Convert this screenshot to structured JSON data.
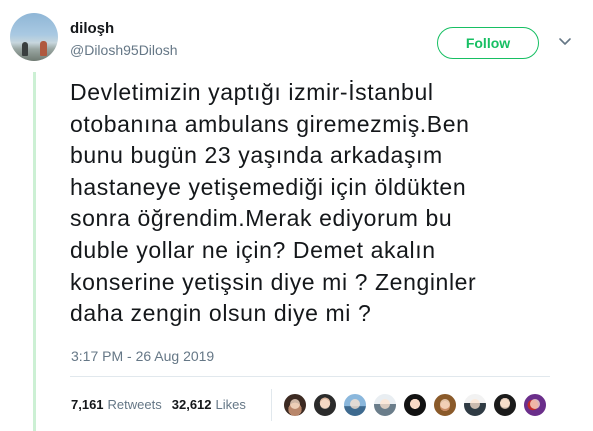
{
  "author": {
    "display_name": "diloşh",
    "handle": "@Dilosh95Dilosh"
  },
  "follow_button": {
    "label": "Follow",
    "accent_color": "#17bf63"
  },
  "menu": {
    "icon": "chevron-down-icon"
  },
  "tweet": {
    "lines": [
      "Devletimizin yaptığı izmir-İstanbul",
      "otobanına ambulans giremezmiş.Ben",
      "bunu bugün 23 yaşında arkadaşım",
      "hastaneye yetişemediği için öldükten",
      "sonra öğrendim.Merak ediyorum bu",
      "duble yollar ne için? Demet akalın",
      "konserine yetişsin diye mi ? Zenginler",
      "daha zengin olsun diye mi ?"
    ],
    "timestamp": "3:17 PM - 26 Aug 2019"
  },
  "stats": {
    "retweets": {
      "count": "7,161",
      "label": "Retweets"
    },
    "likes": {
      "count": "32,612",
      "label": "Likes"
    }
  },
  "likers": [
    {
      "icon": "user-avatar"
    },
    {
      "icon": "user-avatar"
    },
    {
      "icon": "user-avatar"
    },
    {
      "icon": "user-avatar"
    },
    {
      "icon": "user-avatar"
    },
    {
      "icon": "user-avatar"
    },
    {
      "icon": "user-avatar"
    },
    {
      "icon": "user-avatar"
    },
    {
      "icon": "user-avatar"
    }
  ]
}
